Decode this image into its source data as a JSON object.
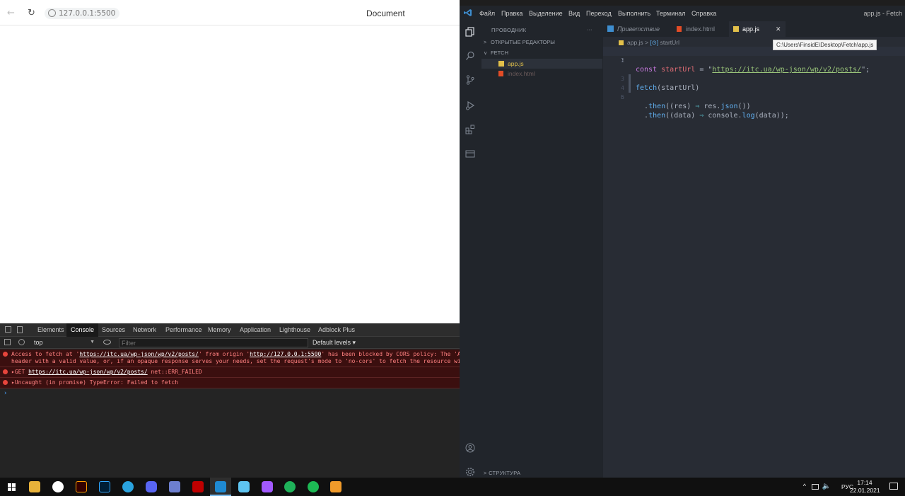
{
  "browser": {
    "url": "127.0.0.1:5500",
    "page_title": "Document",
    "back_glyph": "←",
    "reload_glyph": "↻"
  },
  "devtools": {
    "tabs": [
      "Elements",
      "Console",
      "Sources",
      "Network",
      "Performance",
      "Memory",
      "Application",
      "Lighthouse",
      "Adblock Plus"
    ],
    "context": "top",
    "filter_placeholder": "Filter",
    "levels": "Default levels",
    "errors": {
      "e1_a": "Access to fetch at '",
      "e1_url": "https://itc.ua/wp-json/wp/v2/posts/",
      "e1_b": "' from origin '",
      "e1_origin": "http://127.0.0.1:5500",
      "e1_c": "' has been blocked by CORS policy: The 'Access-Contro",
      "e1_line2": "header with a valid value, or, if an opaque response serves your needs, set the request's mode to 'no-cors' to fetch the resource with CORS disa",
      "e2_a": "▸GET ",
      "e2_url": "https://itc.ua/wp-json/wp/v2/posts/",
      "e2_b": " net::ERR_FAILED",
      "e3": "▸Uncaught (in promise) TypeError: Failed to fetch"
    },
    "prompt": "›"
  },
  "vscode": {
    "menu": [
      "Файл",
      "Правка",
      "Выделение",
      "Вид",
      "Переход",
      "Выполнить",
      "Терминал",
      "Справка"
    ],
    "window_title": "app.js - Fetch",
    "explorer_title": "ПРОВОДНИК",
    "explorer_more": "···",
    "open_editors": "ОТКРЫТЫЕ РЕДАКТОРЫ",
    "folder": "FETCH",
    "files": [
      "app.js",
      "index.html"
    ],
    "outline": "СТРУКТУРА",
    "tabs": {
      "welcome": "Приветствие",
      "index": "index.html",
      "app": "app.js",
      "close": "✕"
    },
    "tooltip": "C:\\Users\\FinsidE\\Desktop\\Fetch\\app.js",
    "breadcrumb": {
      "file": "app.js",
      "sep": ">",
      "symbol": "startUrl"
    },
    "line_numbers": [
      "1",
      "2",
      "3",
      "4",
      "5",
      "6"
    ],
    "code": {
      "l1_kw": "const ",
      "l1_var": "startUrl",
      "l1_eq": " = \"",
      "l1_str": "https://itc.ua/wp-json/wp/v2/posts/",
      "l1_end": "\";",
      "l3_fn": "fetch",
      "l3_rest": "(startUrl)",
      "l4_a": "  .",
      "l4_fn": "then",
      "l4_b": "((res) ",
      "l4_arrow": "⇒",
      "l4_c": " res.",
      "l4_fn2": "json",
      "l4_d": "())",
      "l5_a": "  .",
      "l5_fn": "then",
      "l5_b": "((data) ",
      "l5_arrow": "⇒",
      "l5_c": " console.",
      "l5_fn2": "log",
      "l5_d": "(data));"
    }
  },
  "taskbar": {
    "lang": "РУС",
    "time": "17:14",
    "date": "22.01.2021",
    "tray_chevron": "^"
  },
  "colors": {
    "vscode_bg": "#282c34",
    "error_bg": "#3b0f0f",
    "accent_blue": "#3e8ed0"
  }
}
